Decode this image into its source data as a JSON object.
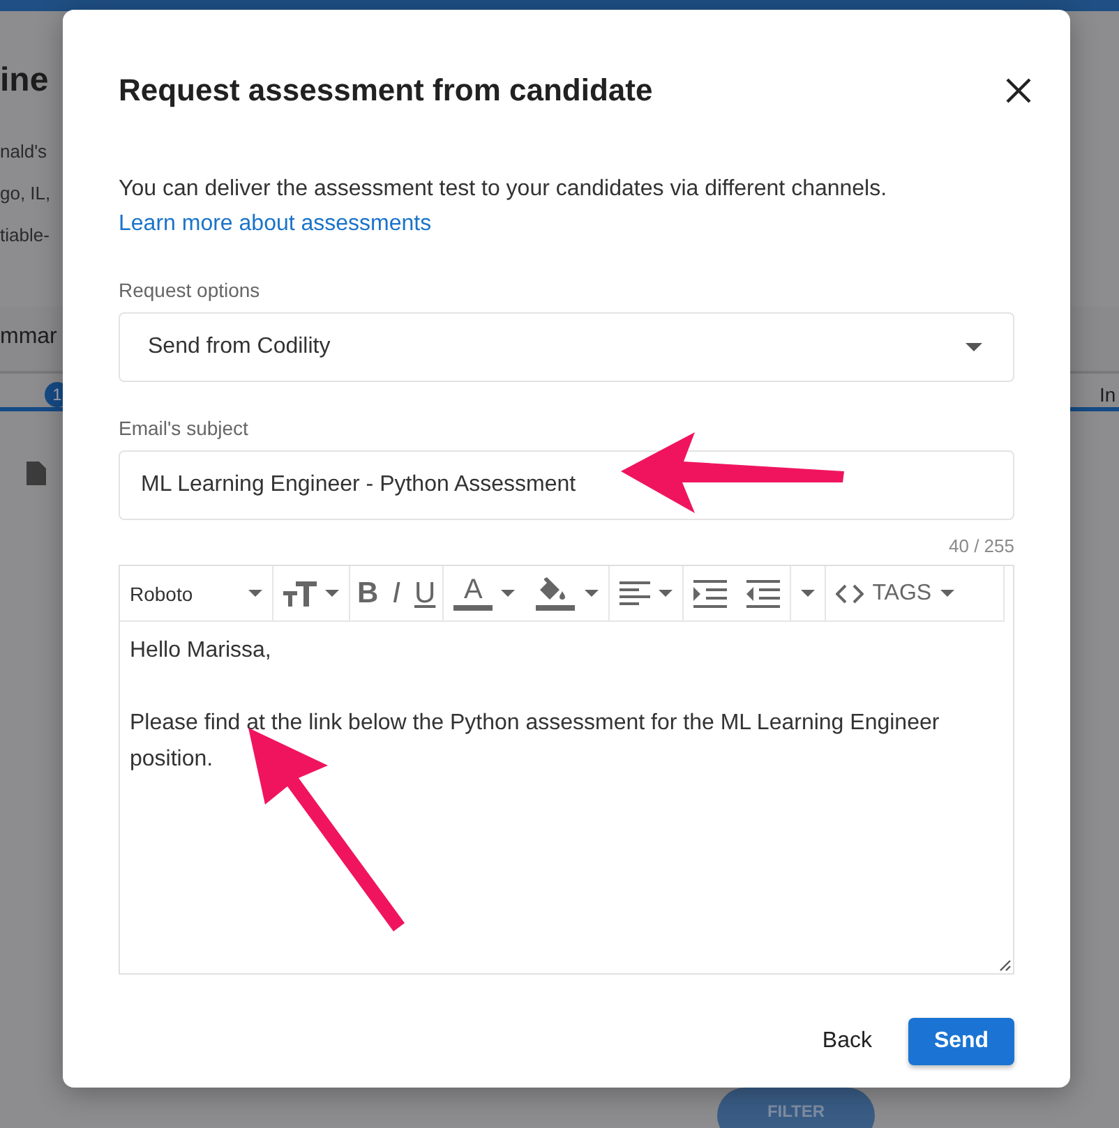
{
  "background": {
    "title_fragment": "ine",
    "company_fragment": "nald's",
    "location_fragment": "go, IL,",
    "tag_fragment": "tiable-",
    "tab_fragment": "mmar",
    "badge": "1",
    "right_tab_fragment": "In",
    "filter_button": "FILTER"
  },
  "dialog": {
    "title": "Request assessment from candidate",
    "intro": "You can deliver the assessment test to your candidates via different channels.",
    "learn_more_link": "Learn more about assessments",
    "request_options": {
      "label": "Request options",
      "value": "Send from Codility"
    },
    "subject": {
      "label": "Email's subject",
      "value": "ML Learning Engineer - Python Assessment",
      "counter": "40 / 255"
    },
    "toolbar": [
      {
        "kind": "font",
        "label": "Roboto"
      },
      {
        "kind": "text-size"
      },
      {
        "kind": "bold",
        "label": "B"
      },
      {
        "kind": "italic",
        "label": "I"
      },
      {
        "kind": "underline",
        "label": "U"
      },
      {
        "kind": "font-color",
        "label": "A"
      },
      {
        "kind": "fill"
      },
      {
        "kind": "align"
      },
      {
        "kind": "indent"
      },
      {
        "kind": "outdent"
      },
      {
        "kind": "more"
      },
      {
        "kind": "tags",
        "label": "TAGS"
      }
    ],
    "body_paragraphs": [
      "Hello Marissa,",
      "Please find at the link below the Python assessment for the ML Learning Engineer position."
    ],
    "buttons": [
      {
        "kind": "text",
        "label": "Back"
      },
      {
        "kind": "primary",
        "label": "Send"
      }
    ]
  }
}
